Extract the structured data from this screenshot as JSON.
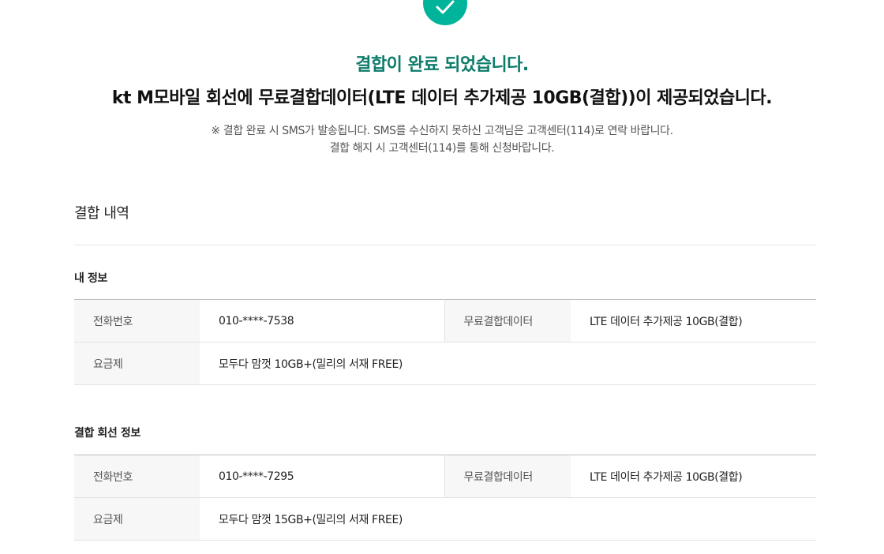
{
  "colors": {
    "accent": "#00b39b",
    "headline_green": "#0e7c6b"
  },
  "icons": {
    "success": "check-icon"
  },
  "header": {
    "success_title": "결합이 완료 되었습니다.",
    "main_message": "kt M모바일 회선에 무료결합데이터(LTE 데이터 추가제공 10GB(결합))이 제공되었습니다.",
    "notice_line1": "※ 결합 완료 시 SMS가 발송됩니다. SMS를 수신하지 못하신 고객님은 고객센터(114)로 연락 바랍니다.",
    "notice_line2": "결합 해지 시 고객센터(114)를 통해 신청바랍니다."
  },
  "section": {
    "title": "결합 내역"
  },
  "my_info": {
    "title": "내 정보",
    "rows": [
      {
        "label": "전화번호",
        "value": "010-****-7538",
        "label2": "무료결합데이터",
        "value2": "LTE 데이터 추가제공 10GB(결합)"
      },
      {
        "label": "요금제",
        "value": "모두다 맘껏 10GB+(밀리의 서재 FREE)"
      }
    ]
  },
  "combined_info": {
    "title": "결합 회선 정보",
    "rows": [
      {
        "label": "전화번호",
        "value": "010-****-7295",
        "label2": "무료결합데이터",
        "value2": "LTE 데이터 추가제공 10GB(결합)"
      },
      {
        "label": "요금제",
        "value": "모두다 맘껏 15GB+(밀리의 서재 FREE)"
      }
    ]
  }
}
